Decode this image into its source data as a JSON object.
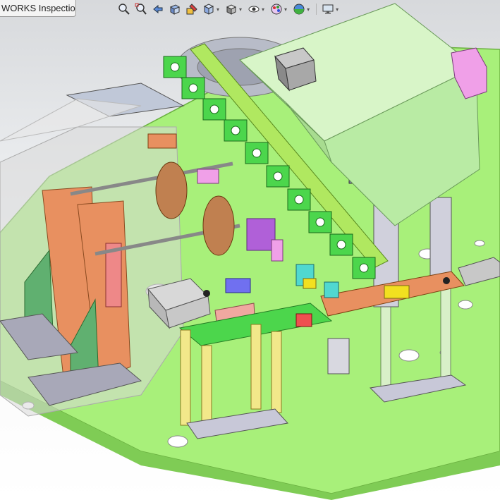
{
  "document_tab": {
    "title": "WORKS Inspection"
  },
  "heads_up_toolbar": {
    "tools": [
      {
        "id": "zoom-to-fit",
        "icon": "zoom-to-fit-icon",
        "has_dropdown": false
      },
      {
        "id": "zoom-to-area",
        "icon": "zoom-to-area-icon",
        "has_dropdown": false
      },
      {
        "id": "previous-view",
        "icon": "previous-view-icon",
        "has_dropdown": false
      },
      {
        "id": "section-view",
        "icon": "section-view-icon",
        "has_dropdown": false
      },
      {
        "id": "dynamic-annotation",
        "icon": "dynamic-annotation-icon",
        "has_dropdown": false
      },
      {
        "id": "view-orientation",
        "icon": "view-orientation-icon",
        "has_dropdown": true
      },
      {
        "id": "display-style",
        "icon": "display-style-icon",
        "has_dropdown": true
      },
      {
        "id": "hide-show-items",
        "icon": "hide-show-items-icon",
        "has_dropdown": true
      },
      {
        "id": "edit-appearance",
        "icon": "edit-appearance-icon",
        "has_dropdown": true
      },
      {
        "id": "apply-scene",
        "icon": "apply-scene-icon",
        "has_dropdown": true
      },
      {
        "id": "view-settings",
        "icon": "monitor-icon",
        "has_dropdown": true
      }
    ]
  },
  "colors": {
    "base_plate": "#a8f07a",
    "cover": "#c9f0b8",
    "bracket_green": "#4cd64c",
    "bracket_yellow": "#f2e88a",
    "pink": "#f0a0e8",
    "orange": "#e89060",
    "grey_block": "#c8c8d8",
    "cyan": "#50d8d0",
    "blue": "#7070f0",
    "salmon": "#f0a8a0",
    "transparent_shell": "#d8d8d8"
  }
}
